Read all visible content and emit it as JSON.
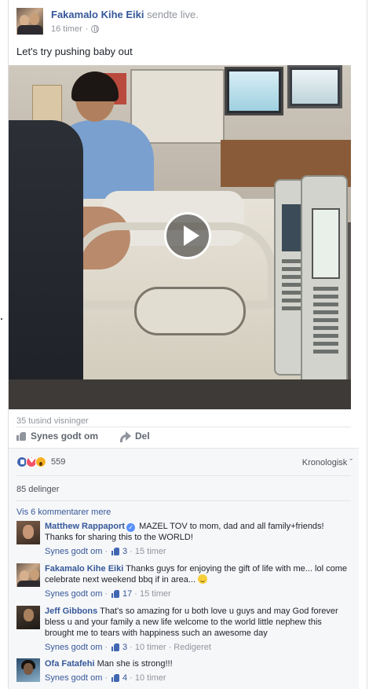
{
  "post": {
    "author": "Fakamalo Kihe Eiki",
    "action": "sendte live.",
    "time": "16 timer",
    "text": "Let's try pushing baby out",
    "video_views": "35 tusind visninger"
  },
  "actions": {
    "like_label": "Synes godt om",
    "share_label": "Del"
  },
  "reactions": {
    "icons": [
      "like-icon",
      "love-icon",
      "wow-icon"
    ],
    "count": "559",
    "sort_label": "Kronologisk ˇ"
  },
  "shares": "85 delinger",
  "more_comments": "Vis 6 kommentarer mere",
  "comments": [
    {
      "name": "Matthew Rappaport",
      "verified": true,
      "text": "MAZEL TOV to mom, dad and all family+friends! Thanks for sharing this to the WORLD!",
      "like_label": "Synes godt om",
      "likes": "3",
      "time": "15 timer",
      "extra": ""
    },
    {
      "name": "Fakamalo Kihe Eiki",
      "verified": false,
      "text": "Thanks guys for enjoying the gift of life with me... lol come celebrate next weekend bbq if in area...",
      "like_label": "Synes godt om",
      "likes": "17",
      "time": "15 timer",
      "extra": ""
    },
    {
      "name": "Jeff Gibbons",
      "verified": false,
      "text": "That's so amazing for u both love u guys and may God forever bless u and your family a new life welcome to the world little nephew this brought me to tears with happiness such an awesome day",
      "like_label": "Synes godt om",
      "likes": "3",
      "time": "10 timer",
      "extra": "Redigeret"
    },
    {
      "name": "Ofa Fatafehi",
      "verified": false,
      "text": "Man she is strong!!!",
      "like_label": "Synes godt om",
      "likes": "4",
      "time": "10 timer",
      "extra": ""
    }
  ],
  "colors": {
    "link": "#365899",
    "meta": "#90949c",
    "section_bg": "#f6f7f9",
    "like_blue": "#4267b2"
  }
}
